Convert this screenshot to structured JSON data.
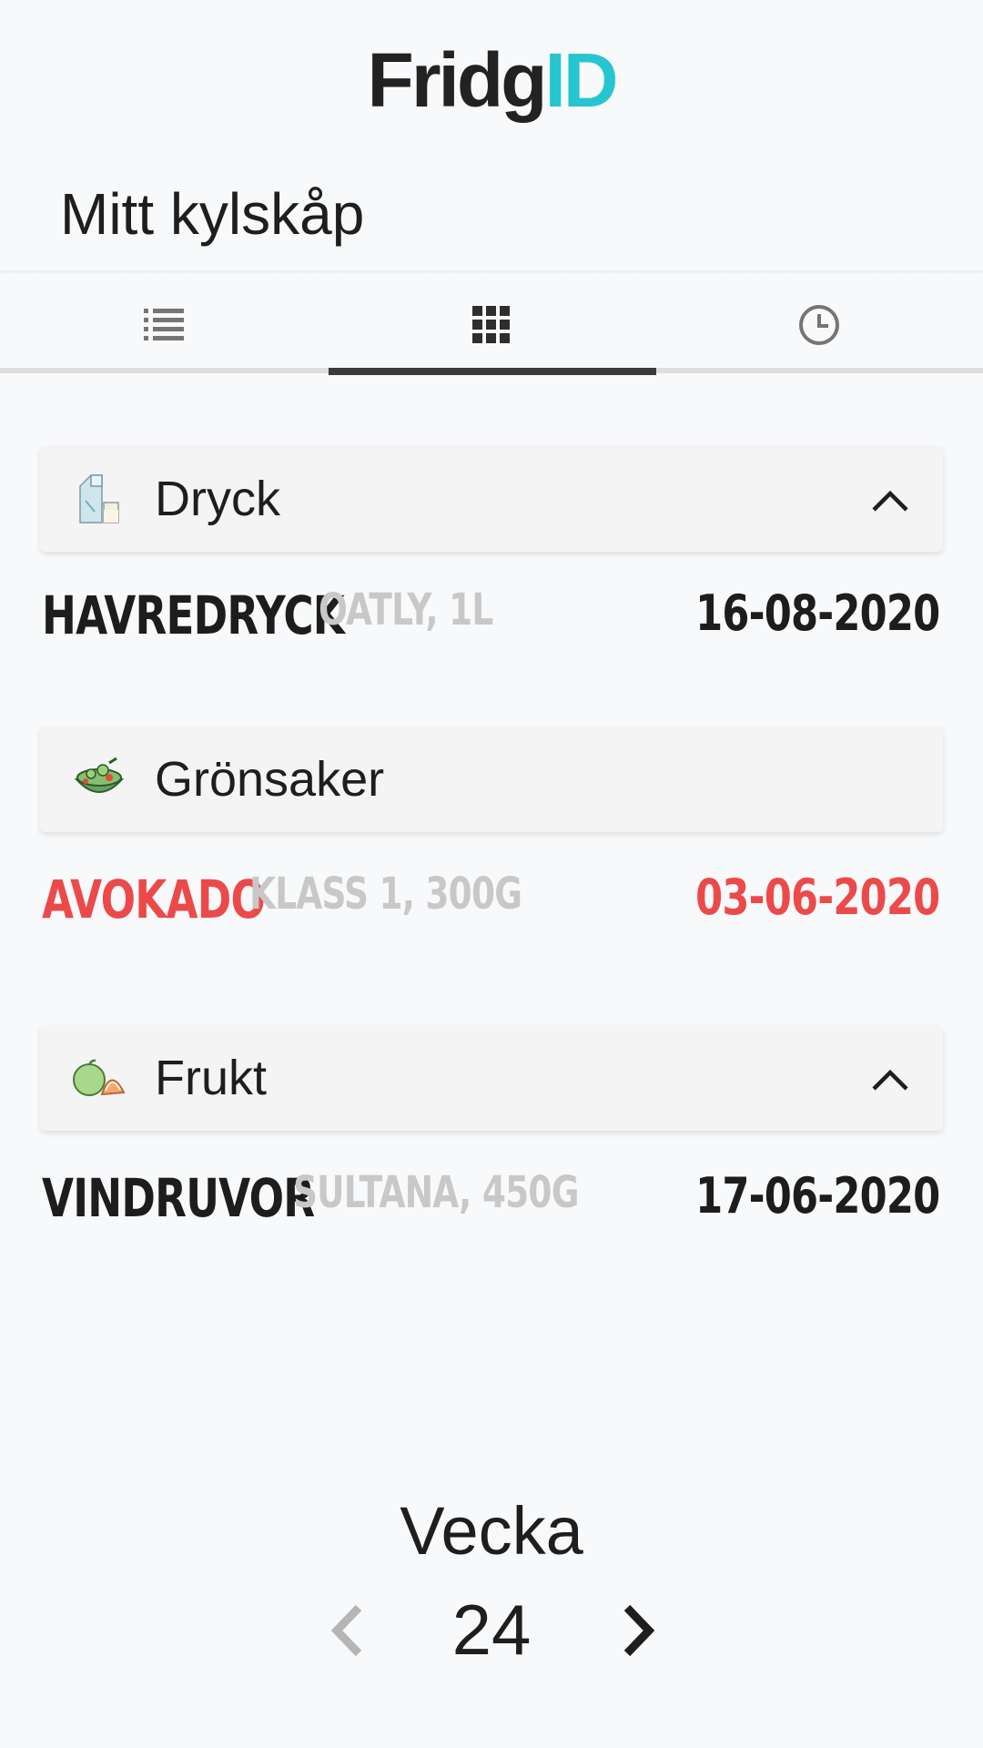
{
  "app": {
    "logo_part1": "Fridg",
    "logo_part2": "ID",
    "accent": "#26c6d0"
  },
  "page_title": "Mitt kylskåp",
  "tabs": [
    {
      "icon": "list-icon",
      "active": false
    },
    {
      "icon": "grid-icon",
      "active": true
    },
    {
      "icon": "clock-icon",
      "active": false
    }
  ],
  "categories": [
    {
      "label": "Dryck",
      "icon": "milk-carton-icon",
      "expanded": true,
      "items": [
        {
          "name": "HAVREDRYCK",
          "desc": "OATLY, 1L",
          "date": "16-08-2020",
          "expired": false
        }
      ]
    },
    {
      "label": "Grönsaker",
      "icon": "salad-bowl-icon",
      "items": [
        {
          "name": "AVOKADO",
          "desc": "KLASS 1, 300G",
          "date": "03-06-2020",
          "expired": true
        }
      ]
    },
    {
      "label": "Frukt",
      "icon": "apple-orange-icon",
      "expanded": true,
      "items": [
        {
          "name": "VINDRUVOR",
          "desc": "SULTANA, 450G",
          "date": "17-06-2020",
          "expired": false
        }
      ]
    }
  ],
  "week": {
    "label": "Vecka",
    "number": "24"
  },
  "colors": {
    "expired": "#ec4a4a",
    "text": "#1e1e1e",
    "muted": "#c8c8c8"
  }
}
